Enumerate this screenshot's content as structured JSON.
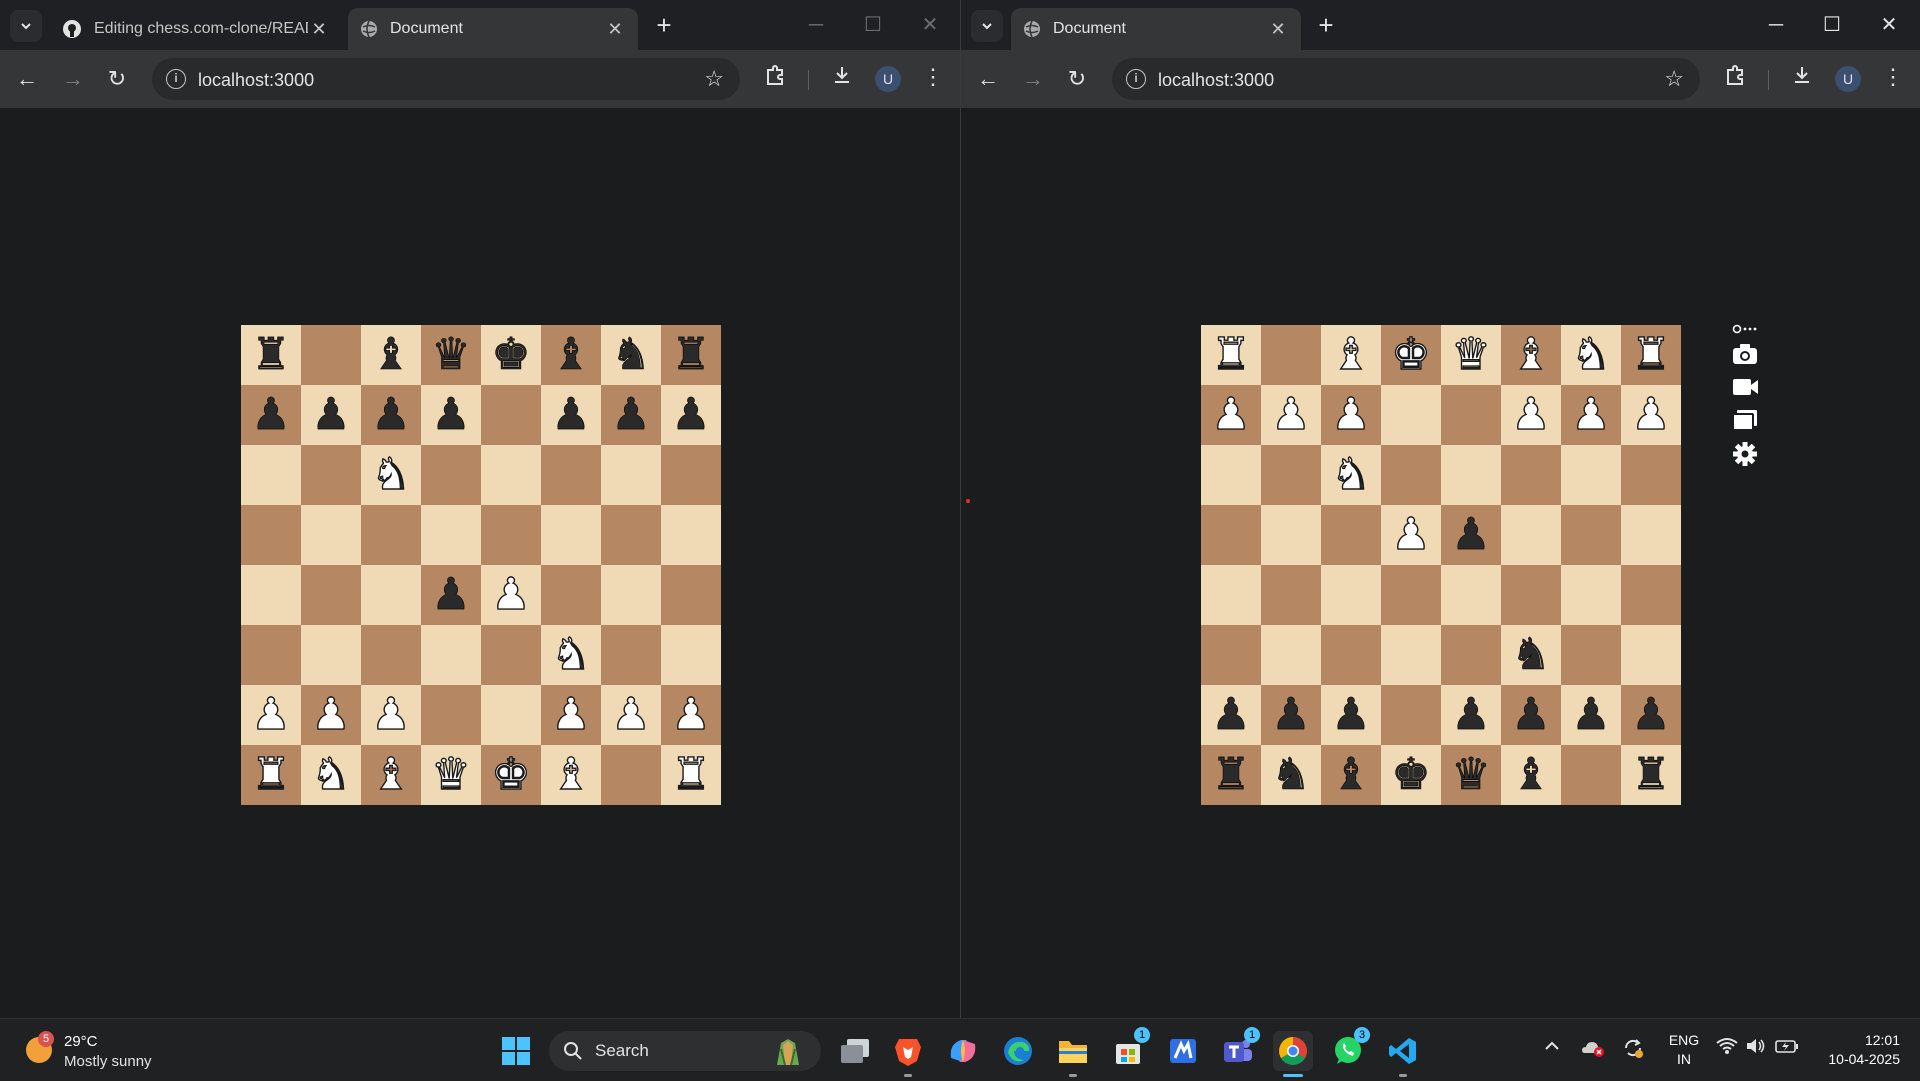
{
  "left_window": {
    "tabs": [
      {
        "title": "Editing chess.com-clone/READM",
        "icon": "github-icon",
        "active": false
      },
      {
        "title": "Document",
        "icon": "globe-icon",
        "active": true
      }
    ],
    "url": "localhost:3000",
    "profile_initial": "U",
    "board": {
      "rows": [
        [
          "bR",
          "",
          "bB",
          "bQ",
          "bK",
          "bB",
          "bN",
          "bR"
        ],
        [
          "bP",
          "bP",
          "bP",
          "bP",
          "",
          "bP",
          "bP",
          "bP"
        ],
        [
          "",
          "",
          "wN",
          "",
          "",
          "",
          "",
          ""
        ],
        [
          "",
          "",
          "",
          "",
          "",
          "",
          "",
          ""
        ],
        [
          "",
          "",
          "",
          "bP",
          "wP",
          "",
          "",
          ""
        ],
        [
          "",
          "",
          "",
          "",
          "",
          "wN",
          "",
          ""
        ],
        [
          "wP",
          "wP",
          "wP",
          "",
          "",
          "wP",
          "wP",
          "wP"
        ],
        [
          "wR",
          "wN",
          "wB",
          "wQ",
          "wK",
          "wB",
          "",
          "wR"
        ]
      ]
    }
  },
  "right_window": {
    "tabs": [
      {
        "title": "Document",
        "icon": "globe-icon",
        "active": true
      }
    ],
    "url": "localhost:3000",
    "profile_initial": "U",
    "board": {
      "rows": [
        [
          "wR",
          "",
          "wB",
          "wK",
          "wQ",
          "wB",
          "wN",
          "wR"
        ],
        [
          "wP",
          "wP",
          "wP",
          "",
          "",
          "wP",
          "wP",
          "wP"
        ],
        [
          "",
          "",
          "wN",
          "",
          "",
          "",
          "",
          ""
        ],
        [
          "",
          "",
          "",
          "wP",
          "bP",
          "",
          "",
          ""
        ],
        [
          "",
          "",
          "",
          "",
          "",
          "",
          "",
          ""
        ],
        [
          "",
          "",
          "",
          "",
          "",
          "bN",
          "",
          ""
        ],
        [
          "bP",
          "bP",
          "bP",
          "",
          "bP",
          "bP",
          "bP",
          "bP"
        ],
        [
          "bR",
          "bN",
          "bB",
          "bK",
          "bQ",
          "bB",
          "",
          "bR"
        ]
      ]
    },
    "side_tools": [
      "link-icon",
      "camera-icon",
      "video-camera-icon",
      "windows-icon",
      "settings-icon"
    ]
  },
  "taskbar": {
    "weather": {
      "temp": "29°C",
      "condition": "Mostly sunny",
      "badge": "5"
    },
    "search_label": "Search",
    "apps": [
      {
        "name": "task-view",
        "badge": ""
      },
      {
        "name": "brave",
        "badge": ""
      },
      {
        "name": "copilot",
        "badge": ""
      },
      {
        "name": "edge",
        "badge": ""
      },
      {
        "name": "file-explorer",
        "badge": ""
      },
      {
        "name": "microsoft-store",
        "badge": "1"
      },
      {
        "name": "app",
        "badge": ""
      },
      {
        "name": "teams",
        "badge": "1"
      },
      {
        "name": "chrome",
        "badge": ""
      },
      {
        "name": "whatsapp",
        "badge": "3"
      },
      {
        "name": "vscode",
        "badge": ""
      }
    ],
    "lang_top": "ENG",
    "lang_bottom": "IN",
    "time": "12:01",
    "date": "10-04-2025"
  },
  "colors": {
    "light_square": "#f0d9b5",
    "dark_square": "#b58863",
    "accent": "#4cc2ff"
  }
}
